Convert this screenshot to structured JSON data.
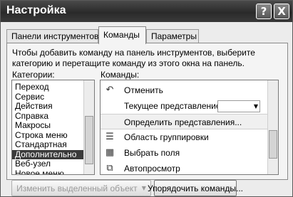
{
  "window": {
    "title": "Настройка",
    "help_label": "?",
    "close_label": "X"
  },
  "tabs": [
    {
      "label": "Панели инструментов"
    },
    {
      "label": "Команды"
    },
    {
      "label": "Параметры"
    }
  ],
  "instructions": "Чтобы добавить команду на панель инструментов, выберите категорию и перетащите команду из этого окна на панель.",
  "categories": {
    "label": "Категории:",
    "items": [
      "Переход",
      "Сервис",
      "Действия",
      "Справка",
      "Макросы",
      "Строка меню",
      "Стандартная",
      "Дополнительно",
      "Веб-узел",
      "Новое меню"
    ],
    "selected": "Дополнительно"
  },
  "commands": {
    "label": "Команды:",
    "items": [
      {
        "label": "Отменить",
        "icon": "undo-icon"
      },
      {
        "label": "Текущее представление",
        "icon": ""
      },
      {
        "label": "Определить представления...",
        "icon": ""
      },
      {
        "label": "Область группировки",
        "icon": "group-area-icon"
      },
      {
        "label": "Выбрать поля",
        "icon": "field-chooser-icon"
      },
      {
        "label": "Автопросмотр",
        "icon": "autopreview-icon"
      }
    ]
  },
  "buttons": {
    "modify_selection": "Изменить выделенный объект",
    "rearrange": "Упорядочить команды..."
  }
}
